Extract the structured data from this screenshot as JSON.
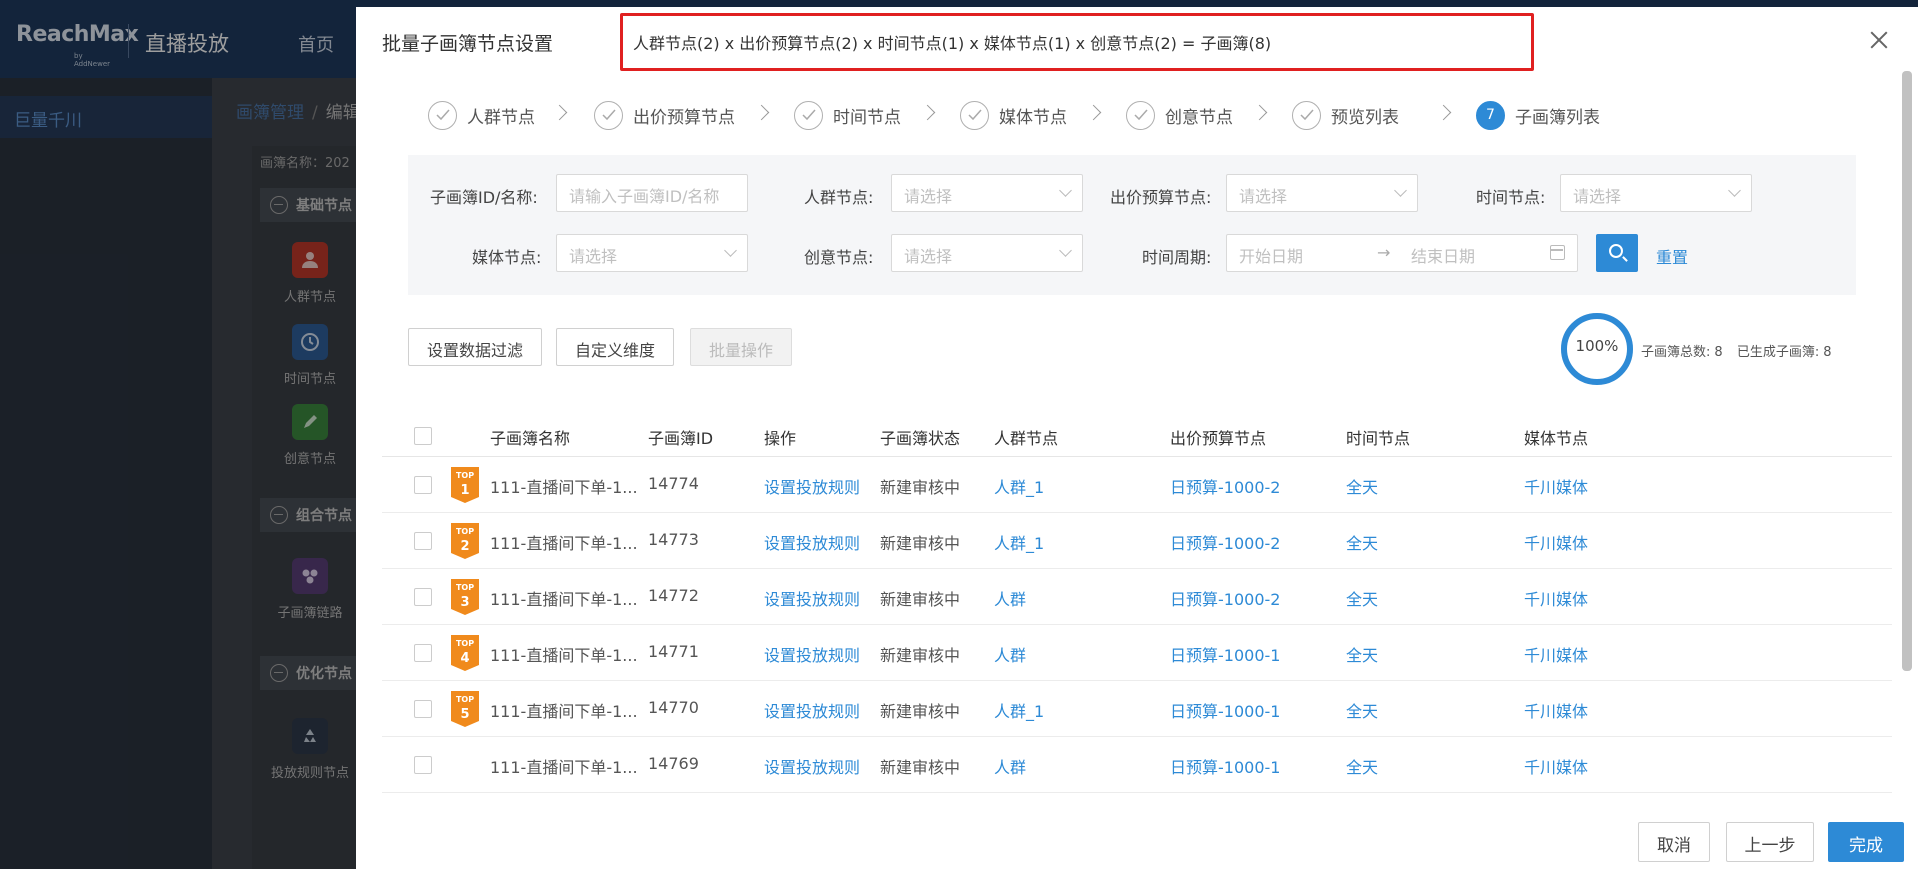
{
  "app": {
    "logo": "ReachMax",
    "logo_sub": "by AddNewer",
    "title": "直播投放",
    "nav_home": "首页",
    "sidebar_active": "巨量千川",
    "breadcrumb": [
      "画簿管理",
      "/",
      "编辑"
    ],
    "canvas_name": "画簿名称：202",
    "node_groups": [
      {
        "label": "基础节点",
        "items": [
          "人群节点",
          "时间节点",
          "创意节点"
        ]
      },
      {
        "label": "组合节点",
        "items": [
          "子画簿链路"
        ]
      },
      {
        "label": "优化节点",
        "items": [
          "投放规则节点"
        ]
      }
    ]
  },
  "modal": {
    "title": "批量子画簿节点设置",
    "formula": "人群节点(2) x 出价预算节点(2) x 时间节点(1) x 媒体节点(1) x 创意节点(2) = 子画簿(8)",
    "steps": [
      {
        "label": "人群节点",
        "status": "done"
      },
      {
        "label": "出价预算节点",
        "status": "done"
      },
      {
        "label": "时间节点",
        "status": "done"
      },
      {
        "label": "媒体节点",
        "status": "done"
      },
      {
        "label": "创意节点",
        "status": "done"
      },
      {
        "label": "预览列表",
        "status": "done"
      },
      {
        "label": "子画簿列表",
        "status": "active",
        "number": "7"
      }
    ],
    "filters": {
      "id_name_label": "子画簿ID/名称:",
      "id_name_placeholder": "请输入子画簿ID/名称",
      "crowd_label": "人群节点:",
      "crowd_placeholder": "请选择",
      "bid_label": "出价预算节点:",
      "bid_placeholder": "请选择",
      "time_label": "时间节点:",
      "time_placeholder": "请选择",
      "media_label": "媒体节点:",
      "media_placeholder": "请选择",
      "creative_label": "创意节点:",
      "creative_placeholder": "请选择",
      "period_label": "时间周期:",
      "start_placeholder": "开始日期",
      "range_arrow": "→",
      "end_placeholder": "结束日期",
      "reset": "重置"
    },
    "toolbar": {
      "filter_btn": "设置数据过滤",
      "dimension_btn": "自定义维度",
      "batch_btn": "批量操作"
    },
    "progress": {
      "percent_text": "100%",
      "percent": 100,
      "total_label": "子画簿总数:",
      "total": "8",
      "generated_label": "已生成子画簿:",
      "generated": "8"
    },
    "table": {
      "columns": [
        "子画簿名称",
        "子画簿ID",
        "操作",
        "子画簿状态",
        "人群节点",
        "出价预算节点",
        "时间节点",
        "媒体节点"
      ],
      "rows": [
        {
          "badge": "1",
          "name": "111-直播间下单-1...",
          "id": "14774",
          "action": "设置投放规则",
          "status": "新建审核中",
          "crowd": "人群_1",
          "bid": "日预算-1000-2",
          "time": "全天",
          "media": "千川媒体"
        },
        {
          "badge": "2",
          "name": "111-直播间下单-1...",
          "id": "14773",
          "action": "设置投放规则",
          "status": "新建审核中",
          "crowd": "人群_1",
          "bid": "日预算-1000-2",
          "time": "全天",
          "media": "千川媒体"
        },
        {
          "badge": "3",
          "name": "111-直播间下单-1...",
          "id": "14772",
          "action": "设置投放规则",
          "status": "新建审核中",
          "crowd": "人群",
          "bid": "日预算-1000-2",
          "time": "全天",
          "media": "千川媒体"
        },
        {
          "badge": "4",
          "name": "111-直播间下单-1...",
          "id": "14771",
          "action": "设置投放规则",
          "status": "新建审核中",
          "crowd": "人群",
          "bid": "日预算-1000-1",
          "time": "全天",
          "media": "千川媒体"
        },
        {
          "badge": "5",
          "name": "111-直播间下单-1...",
          "id": "14770",
          "action": "设置投放规则",
          "status": "新建审核中",
          "crowd": "人群_1",
          "bid": "日预算-1000-1",
          "time": "全天",
          "media": "千川媒体"
        },
        {
          "badge": "",
          "name": "111-直播间下单-1...",
          "id": "14769",
          "action": "设置投放规则",
          "status": "新建审核中",
          "crowd": "人群",
          "bid": "日预算-1000-1",
          "time": "全天",
          "media": "千川媒体"
        }
      ],
      "badge_prefix": "TOP"
    },
    "footer": {
      "cancel": "取消",
      "prev": "上一步",
      "done": "完成"
    }
  },
  "colors": {
    "primary": "#2d8ad6",
    "highlight_border": "#e02020",
    "badge_orange": "#f08a1c"
  }
}
